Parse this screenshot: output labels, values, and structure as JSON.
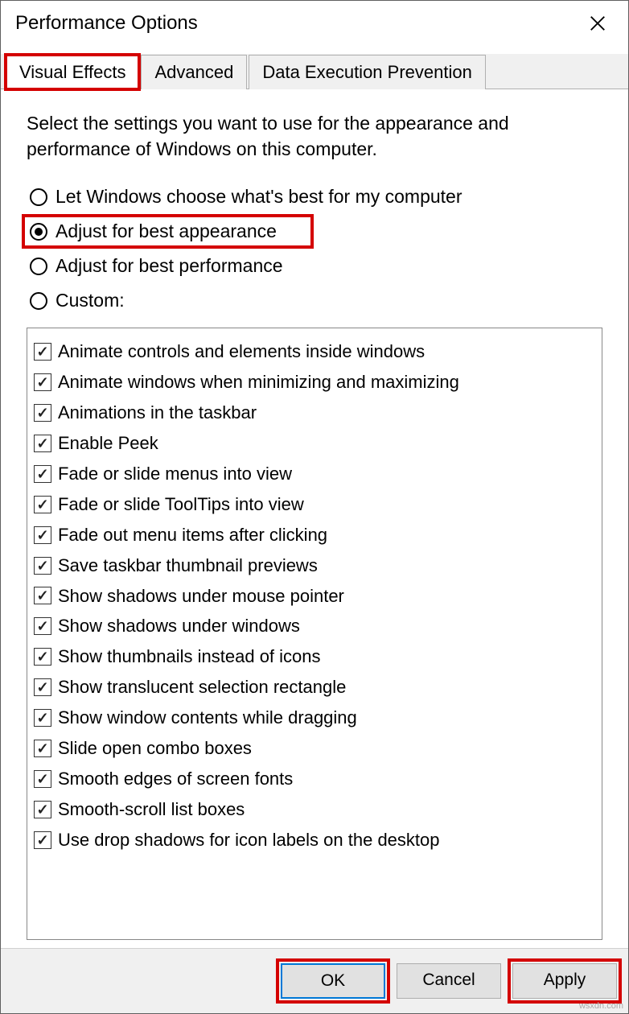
{
  "window": {
    "title": "Performance Options"
  },
  "tabs": [
    {
      "label": "Visual Effects",
      "active": true,
      "highlight": true
    },
    {
      "label": "Advanced",
      "active": false,
      "highlight": false
    },
    {
      "label": "Data Execution Prevention",
      "active": false,
      "highlight": false
    }
  ],
  "description": "Select the settings you want to use for the appearance and performance of Windows on this computer.",
  "radios": [
    {
      "label": "Let Windows choose what's best for my computer",
      "selected": false,
      "highlight": false
    },
    {
      "label": "Adjust for best appearance",
      "selected": true,
      "highlight": true
    },
    {
      "label": "Adjust for best performance",
      "selected": false,
      "highlight": false
    },
    {
      "label": "Custom:",
      "selected": false,
      "highlight": false
    }
  ],
  "checklist": [
    {
      "label": "Animate controls and elements inside windows",
      "checked": true
    },
    {
      "label": "Animate windows when minimizing and maximizing",
      "checked": true
    },
    {
      "label": "Animations in the taskbar",
      "checked": true
    },
    {
      "label": "Enable Peek",
      "checked": true
    },
    {
      "label": "Fade or slide menus into view",
      "checked": true
    },
    {
      "label": "Fade or slide ToolTips into view",
      "checked": true
    },
    {
      "label": "Fade out menu items after clicking",
      "checked": true
    },
    {
      "label": "Save taskbar thumbnail previews",
      "checked": true
    },
    {
      "label": "Show shadows under mouse pointer",
      "checked": true
    },
    {
      "label": "Show shadows under windows",
      "checked": true
    },
    {
      "label": "Show thumbnails instead of icons",
      "checked": true
    },
    {
      "label": "Show translucent selection rectangle",
      "checked": true
    },
    {
      "label": "Show window contents while dragging",
      "checked": true
    },
    {
      "label": "Slide open combo boxes",
      "checked": true
    },
    {
      "label": "Smooth edges of screen fonts",
      "checked": true
    },
    {
      "label": "Smooth-scroll list boxes",
      "checked": true
    },
    {
      "label": "Use drop shadows for icon labels on the desktop",
      "checked": true
    }
  ],
  "buttons": {
    "ok": "OK",
    "cancel": "Cancel",
    "apply": "Apply"
  },
  "watermark": "wsxdn.com"
}
